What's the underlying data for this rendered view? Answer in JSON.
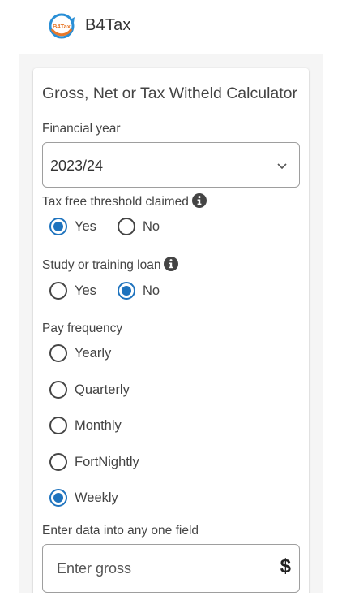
{
  "header": {
    "logo_text": "B4Tax",
    "brand": "B4Tax"
  },
  "form": {
    "title": "Gross, Net or Tax Witheld Calculator",
    "financial_year": {
      "label": "Financial year",
      "value": "2023/24",
      "icon": "chevron-down-icon"
    },
    "tax_free_threshold": {
      "label": "Tax free threshold claimed",
      "icon": "info-icon",
      "options": [
        "Yes",
        "No"
      ],
      "selected": "Yes"
    },
    "study_loan": {
      "label": "Study or training loan",
      "icon": "info-icon",
      "options": [
        "Yes",
        "No"
      ],
      "selected": "No"
    },
    "pay_frequency": {
      "label": "Pay frequency",
      "options": [
        "Yearly",
        "Quarterly",
        "Monthly",
        "FortNightly",
        "Weekly"
      ],
      "selected": "Weekly"
    },
    "entry": {
      "label": "Enter data into any one field",
      "gross_placeholder": "Enter gross",
      "currency_symbol": "$"
    }
  },
  "colors": {
    "accent": "#1e73be",
    "logo_orange": "#e8782a",
    "logo_blue": "#2a8fd6"
  }
}
